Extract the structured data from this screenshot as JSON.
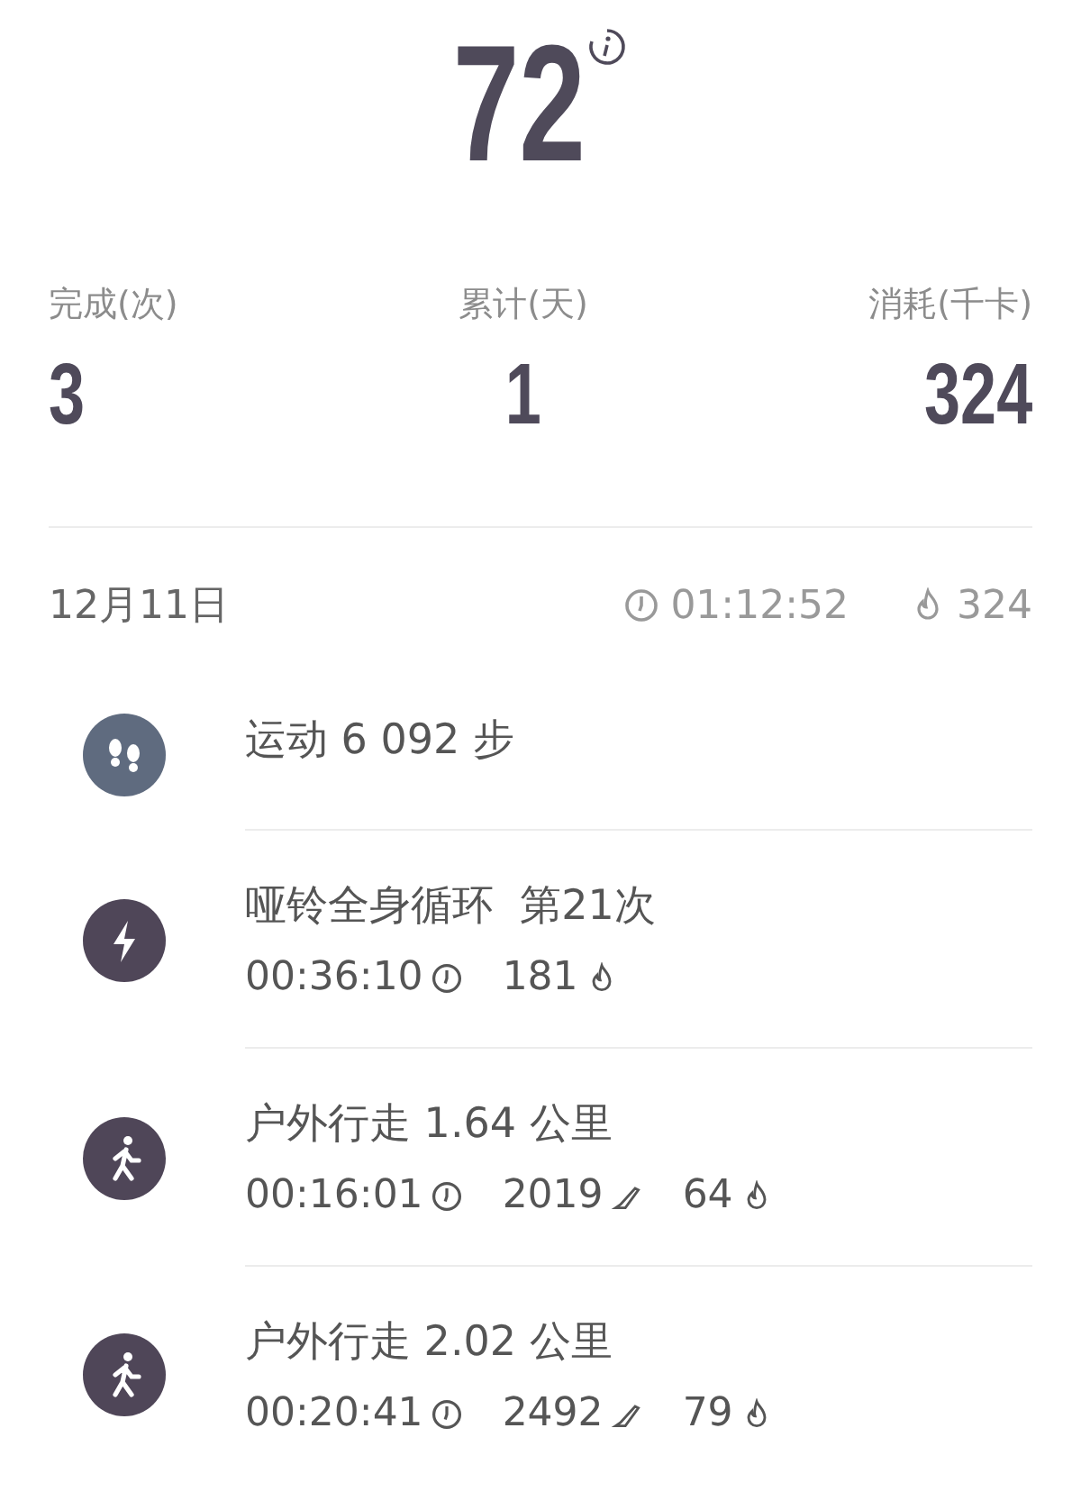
{
  "score": {
    "value": "72"
  },
  "stats": [
    {
      "label": "完成(次)",
      "value": "3"
    },
    {
      "label": "累计(天)",
      "value": "1"
    },
    {
      "label": "消耗(千卡)",
      "value": "324"
    }
  ],
  "day": {
    "date": "12月11日",
    "duration": "01:12:52",
    "calories": "324"
  },
  "activities": [
    {
      "kind": "steps",
      "title": "运动 6 092 步"
    },
    {
      "kind": "workout",
      "title": "哑铃全身循环  第21次",
      "metrics": [
        {
          "kind": "time",
          "value": "00:36:10"
        },
        {
          "kind": "calories",
          "value": "181"
        }
      ]
    },
    {
      "kind": "walk",
      "title": "户外行走 1.64 公里",
      "metrics": [
        {
          "kind": "time",
          "value": "00:16:01"
        },
        {
          "kind": "steps",
          "value": "2019"
        },
        {
          "kind": "calories",
          "value": "64"
        }
      ]
    },
    {
      "kind": "walk",
      "title": "户外行走 2.02 公里",
      "metrics": [
        {
          "kind": "time",
          "value": "00:20:41"
        },
        {
          "kind": "steps",
          "value": "2492"
        },
        {
          "kind": "calories",
          "value": "79"
        }
      ]
    }
  ]
}
